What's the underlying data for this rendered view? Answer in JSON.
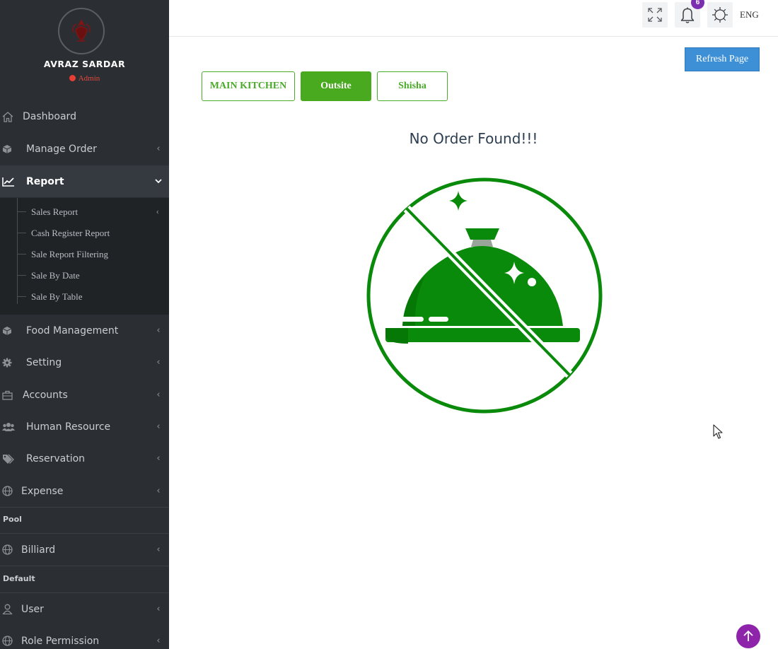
{
  "profile": {
    "name": "AVRAZ SARDAR",
    "role": "Admin"
  },
  "sidebar": {
    "items": [
      {
        "label": "Dashboard",
        "icon": "home-icon"
      },
      {
        "label": "Manage Order",
        "icon": "cube-icon"
      },
      {
        "label": "Report",
        "icon": "chart-line-icon"
      },
      {
        "label": "Food Management",
        "icon": "cube-icon"
      },
      {
        "label": "Setting",
        "icon": "gear-icon"
      },
      {
        "label": "Accounts",
        "icon": "briefcase-icon"
      },
      {
        "label": "Human Resource",
        "icon": "users-icon"
      },
      {
        "label": "Reservation",
        "icon": "tags-icon"
      },
      {
        "label": "Expense",
        "icon": "globe-icon"
      },
      {
        "label": "Billiard",
        "icon": "globe-icon"
      },
      {
        "label": "User",
        "icon": "user-icon"
      },
      {
        "label": "Role Permission",
        "icon": "globe-icon"
      }
    ],
    "report_submenu": [
      {
        "label": "Sales Report"
      },
      {
        "label": "Cash Register Report"
      },
      {
        "label": "Sale Report Filtering"
      },
      {
        "label": "Sale By Date"
      },
      {
        "label": "Sale By Table"
      }
    ],
    "sections": {
      "pool": "Pool",
      "default": "Default"
    }
  },
  "topbar": {
    "notification_count": "6",
    "language": "ENG"
  },
  "main": {
    "refresh_label": "Refresh Page",
    "tabs": [
      {
        "label": "MAIN KITCHEN"
      },
      {
        "label": "Outsite"
      },
      {
        "label": "Shisha"
      }
    ],
    "active_tab": "Outsite",
    "empty_message": "No Order Found!!!"
  },
  "colors": {
    "sidebar_bg": "#2b2f33",
    "accent_green": "#4aaa1f",
    "illustration_green": "#0a8a0a",
    "refresh_blue": "#3d8fd6",
    "badge_purple": "#7a2eb0",
    "scroll_top_purple": "#8e24aa",
    "role_red": "#e83e33"
  }
}
